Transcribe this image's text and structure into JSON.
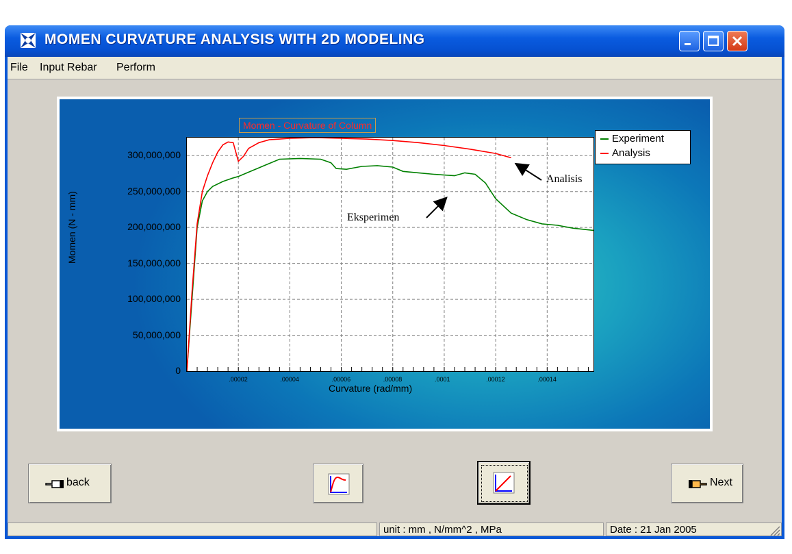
{
  "window": {
    "title": "MOMEN CURVATURE ANALYSIS WITH 2D MODELING",
    "icon": "puzzle-star-icon"
  },
  "menu": [
    "File",
    "Input Rebar",
    "Perform"
  ],
  "chart_data": {
    "type": "line",
    "title": "Momen - Curvature of Column",
    "xlabel": "Curvature (rad/mm)",
    "ylabel": "Momen (N - mm)",
    "xlim": [
      0,
      0.000158
    ],
    "ylim": [
      0,
      325000000
    ],
    "x_ticks": [
      ".00002",
      ".00004",
      ".00006",
      ".00008",
      ".0001",
      ".00012",
      ".00014"
    ],
    "y_ticks": [
      "0",
      "50,000,000",
      "100,000,000",
      "150,000,000",
      "200,000,000",
      "250,000,000",
      "300,000,000"
    ],
    "grid": true,
    "legend": "right",
    "series": [
      {
        "name": "Experiment",
        "color": "#008000",
        "x": [
          0,
          2e-06,
          4e-06,
          6e-06,
          8e-06,
          1e-05,
          1.4e-05,
          1.8e-05,
          2e-05,
          2.4e-05,
          3e-05,
          3.6e-05,
          4.4e-05,
          5.2e-05,
          5.6e-05,
          5.8e-05,
          6.2e-05,
          6.8e-05,
          7.4e-05,
          8e-05,
          8.4e-05,
          9e-05,
          9.6e-05,
          0.0001,
          0.000104,
          0.000108,
          0.000112,
          0.000116,
          0.00012,
          0.000126,
          0.000132,
          0.000138,
          0.000144,
          0.00015,
          0.000158
        ],
        "y": [
          0,
          100000000,
          200000000,
          237000000,
          250000000,
          257000000,
          264000000,
          269000000,
          271000000,
          277000000,
          286000000,
          295000000,
          296000000,
          295000000,
          290000000,
          282000000,
          281000000,
          285000000,
          286000000,
          284000000,
          278000000,
          276000000,
          274000000,
          273000000,
          272000000,
          276000000,
          274000000,
          262000000,
          240000000,
          220000000,
          211000000,
          205000000,
          203000000,
          199000000,
          196000000
        ]
      },
      {
        "name": "Analysis",
        "color": "#ff0000",
        "x": [
          0,
          2e-06,
          4e-06,
          6e-06,
          8e-06,
          1e-05,
          1.2e-05,
          1.4e-05,
          1.6e-05,
          1.8e-05,
          2e-05,
          2.2e-05,
          2.4e-05,
          2.8e-05,
          3.2e-05,
          3.6e-05,
          4e-05,
          5e-05,
          6e-05,
          7e-05,
          8e-05,
          9e-05,
          0.0001,
          0.00011,
          0.00012,
          0.000126
        ],
        "y": [
          0,
          110000000,
          205000000,
          250000000,
          272000000,
          290000000,
          305000000,
          315000000,
          319000000,
          318000000,
          292000000,
          299000000,
          310000000,
          318000000,
          322000000,
          323000000,
          324000000,
          325000000,
          324000000,
          323000000,
          321000000,
          318000000,
          314000000,
          309000000,
          303000000,
          297000000
        ]
      }
    ],
    "annotations": [
      "Analisis",
      "Eksperimen"
    ]
  },
  "buttons": {
    "back": "back",
    "next": "Next",
    "chart1_icon": "curve-chart-icon",
    "chart2_icon": "linear-chart-icon",
    "back_icon": "hand-point-left-icon",
    "next_icon": "hand-point-right-icon"
  },
  "status": {
    "panel1": "",
    "units": "unit : mm , N/mm^2 , MPa",
    "date": "Date : 21 Jan 2005"
  }
}
